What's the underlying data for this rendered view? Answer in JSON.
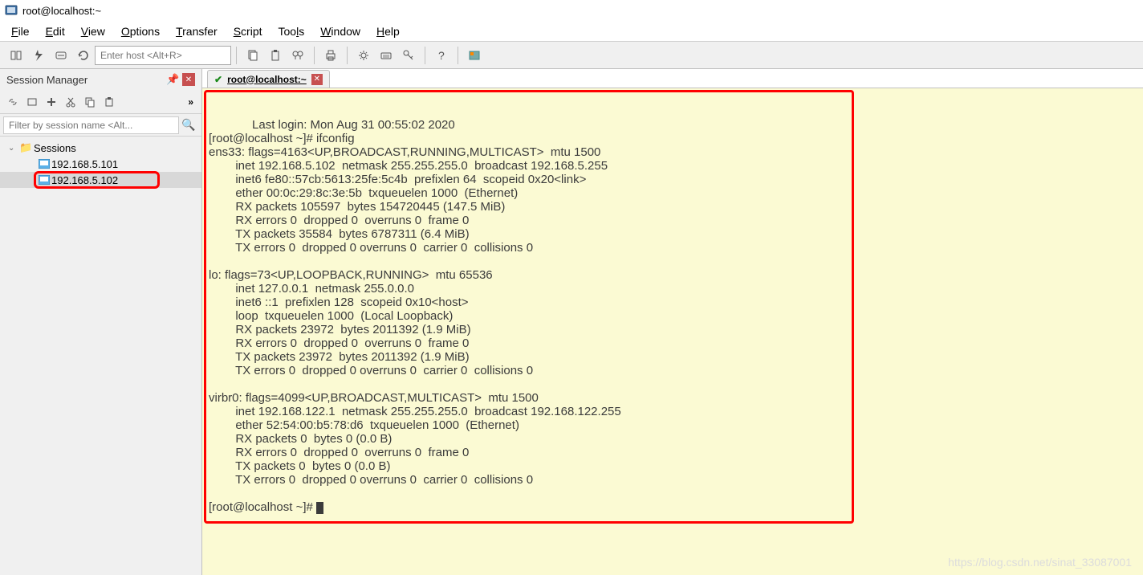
{
  "window": {
    "title": "root@localhost:~"
  },
  "menu": {
    "file": "File",
    "edit": "Edit",
    "view": "View",
    "options": "Options",
    "transfer": "Transfer",
    "script": "Script",
    "tools": "Tools",
    "window": "Window",
    "help": "Help"
  },
  "toolbar": {
    "host_placeholder": "Enter host <Alt+R>"
  },
  "session_manager": {
    "title": "Session Manager",
    "filter_placeholder": "Filter by session name <Alt...",
    "root_label": "Sessions",
    "items": [
      {
        "label": "192.168.5.101"
      },
      {
        "label": "192.168.5.102"
      }
    ]
  },
  "tab": {
    "title": "root@localhost:~"
  },
  "terminal": {
    "lines": [
      "Last login: Mon Aug 31 00:55:02 2020",
      "[root@localhost ~]# ifconfig",
      "ens33: flags=4163<UP,BROADCAST,RUNNING,MULTICAST>  mtu 1500",
      "        inet 192.168.5.102  netmask 255.255.255.0  broadcast 192.168.5.255",
      "        inet6 fe80::57cb:5613:25fe:5c4b  prefixlen 64  scopeid 0x20<link>",
      "        ether 00:0c:29:8c:3e:5b  txqueuelen 1000  (Ethernet)",
      "        RX packets 105597  bytes 154720445 (147.5 MiB)",
      "        RX errors 0  dropped 0  overruns 0  frame 0",
      "        TX packets 35584  bytes 6787311 (6.4 MiB)",
      "        TX errors 0  dropped 0 overruns 0  carrier 0  collisions 0",
      "",
      "lo: flags=73<UP,LOOPBACK,RUNNING>  mtu 65536",
      "        inet 127.0.0.1  netmask 255.0.0.0",
      "        inet6 ::1  prefixlen 128  scopeid 0x10<host>",
      "        loop  txqueuelen 1000  (Local Loopback)",
      "        RX packets 23972  bytes 2011392 (1.9 MiB)",
      "        RX errors 0  dropped 0  overruns 0  frame 0",
      "        TX packets 23972  bytes 2011392 (1.9 MiB)",
      "        TX errors 0  dropped 0 overruns 0  carrier 0  collisions 0",
      "",
      "virbr0: flags=4099<UP,BROADCAST,MULTICAST>  mtu 1500",
      "        inet 192.168.122.1  netmask 255.255.255.0  broadcast 192.168.122.255",
      "        ether 52:54:00:b5:78:d6  txqueuelen 1000  (Ethernet)",
      "        RX packets 0  bytes 0 (0.0 B)",
      "        RX errors 0  dropped 0  overruns 0  frame 0",
      "        TX packets 0  bytes 0 (0.0 B)",
      "        TX errors 0  dropped 0 overruns 0  carrier 0  collisions 0",
      "",
      "[root@localhost ~]# "
    ]
  },
  "watermark": "https://blog.csdn.net/sinat_33087001"
}
